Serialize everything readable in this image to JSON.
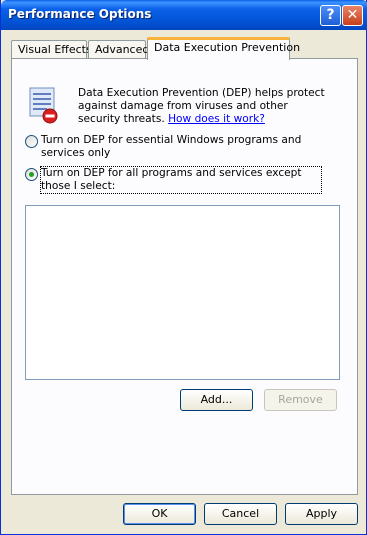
{
  "window": {
    "title": "Performance Options",
    "help_glyph": "?",
    "close_glyph": "✕"
  },
  "tabs": [
    {
      "label": "Visual Effects"
    },
    {
      "label": "Advanced"
    },
    {
      "label": "Data Execution Prevention",
      "active": true
    }
  ],
  "dep": {
    "description": "Data Execution Prevention (DEP) helps protect against damage from viruses and other security threats.",
    "link": "How does it work?",
    "option_essential": "Turn on DEP for essential Windows programs and services only",
    "option_all": "Turn on DEP for all programs and services except those I select:",
    "selected_option": "all",
    "icon": "dep-shield-icon"
  },
  "list": {
    "items": []
  },
  "buttons": {
    "add": "Add...",
    "remove": "Remove",
    "ok": "OK",
    "cancel": "Cancel",
    "apply": "Apply"
  },
  "colors": {
    "titlebar": "#0354d6",
    "active_tab_accent": "#f9b33a",
    "link": "#0000ff"
  }
}
